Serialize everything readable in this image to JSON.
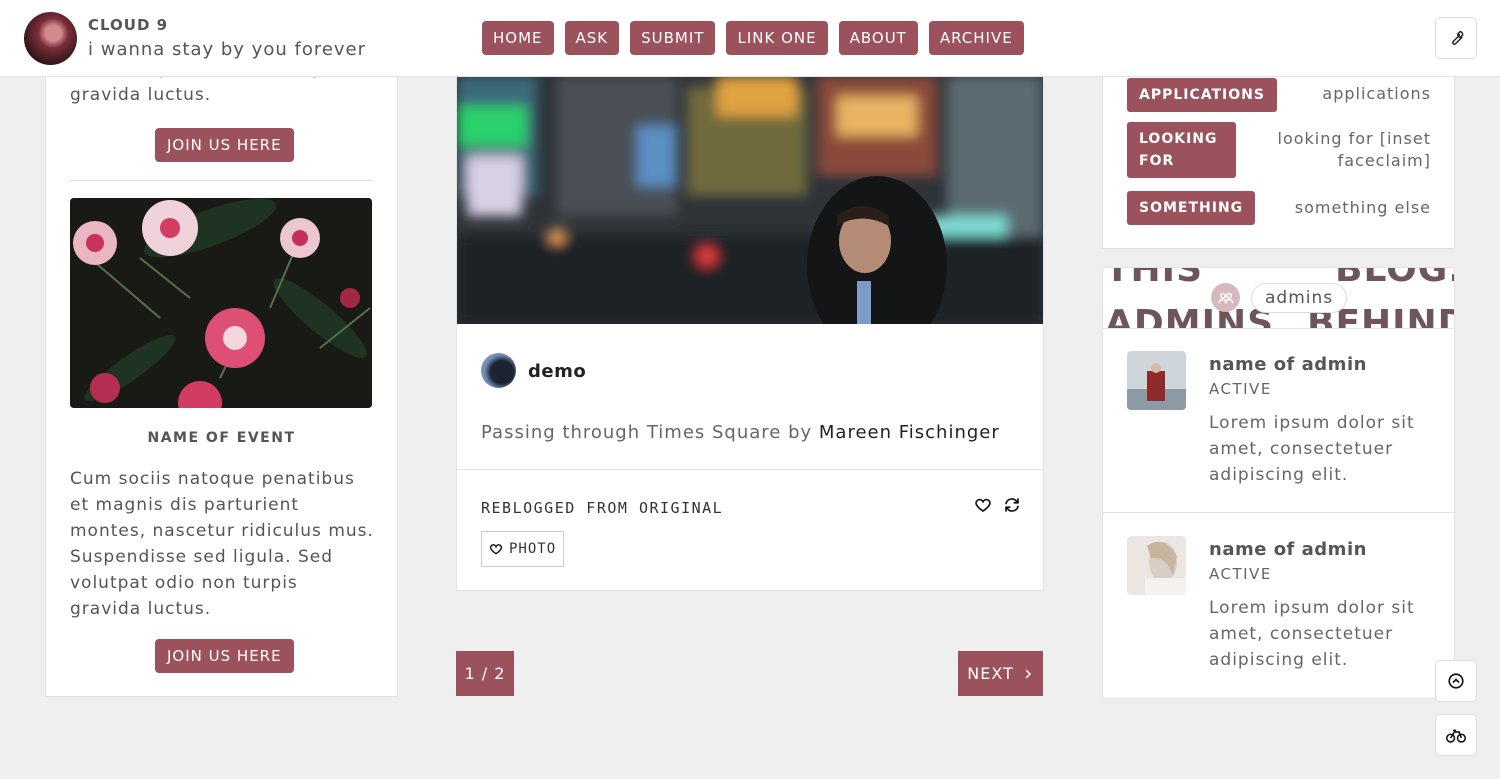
{
  "header": {
    "blog_title": "CLOUD 9",
    "blog_description": "i wanna stay by you forever",
    "nav": [
      "HOME",
      "ASK",
      "SUBMIT",
      "LINK ONE",
      "ABOUT",
      "ARCHIVE"
    ]
  },
  "left": {
    "top_text": "Sed volutpat odio non turpis gravida luctus.",
    "join_label_1": "JOIN US HERE",
    "event_name": "NAME OF EVENT",
    "event_desc": "Cum sociis natoque penatibus et magnis dis parturient montes, nascetur ridiculus mus. Suspendisse sed ligula. Sed volutpat odio non turpis gravida luctus.",
    "join_label_2": "JOIN US HERE"
  },
  "post": {
    "author": "demo",
    "caption_prefix": "Passing through Times Square by ",
    "caption_credit": "Mareen Fischinger",
    "reblog_text": "REBLOGGED FROM ORIGINAL",
    "tag": "PHOTO"
  },
  "pagination": {
    "page": "1 / 2",
    "next": "NEXT"
  },
  "info": [
    {
      "key": "APPLICATIONS",
      "value": "applications"
    },
    {
      "key": "LOOKING FOR",
      "value": "looking for [inset faceclaim]"
    },
    {
      "key": "SOMETHING",
      "value": "something else"
    }
  ],
  "admins": {
    "banner_top": [
      "THIS",
      "BLOG."
    ],
    "banner_bottom": [
      "ADMINS",
      "BEHIND"
    ],
    "label": "admins",
    "list": [
      {
        "name": "name of admin",
        "status": "ACTIVE",
        "bio": "Lorem ipsum dolor sit amet, consectetuer adipiscing elit."
      },
      {
        "name": "name of admin",
        "status": "ACTIVE",
        "bio": "Lorem ipsum dolor sit amet, consectetuer adipiscing elit."
      }
    ]
  },
  "colors": {
    "accent": "#9b525c",
    "background": "#f0efef"
  },
  "icons": [
    "wrench-icon",
    "heart-icon",
    "reblog-icon",
    "chevron-right-icon",
    "scroll-top-icon",
    "bike-icon",
    "group-icon"
  ]
}
